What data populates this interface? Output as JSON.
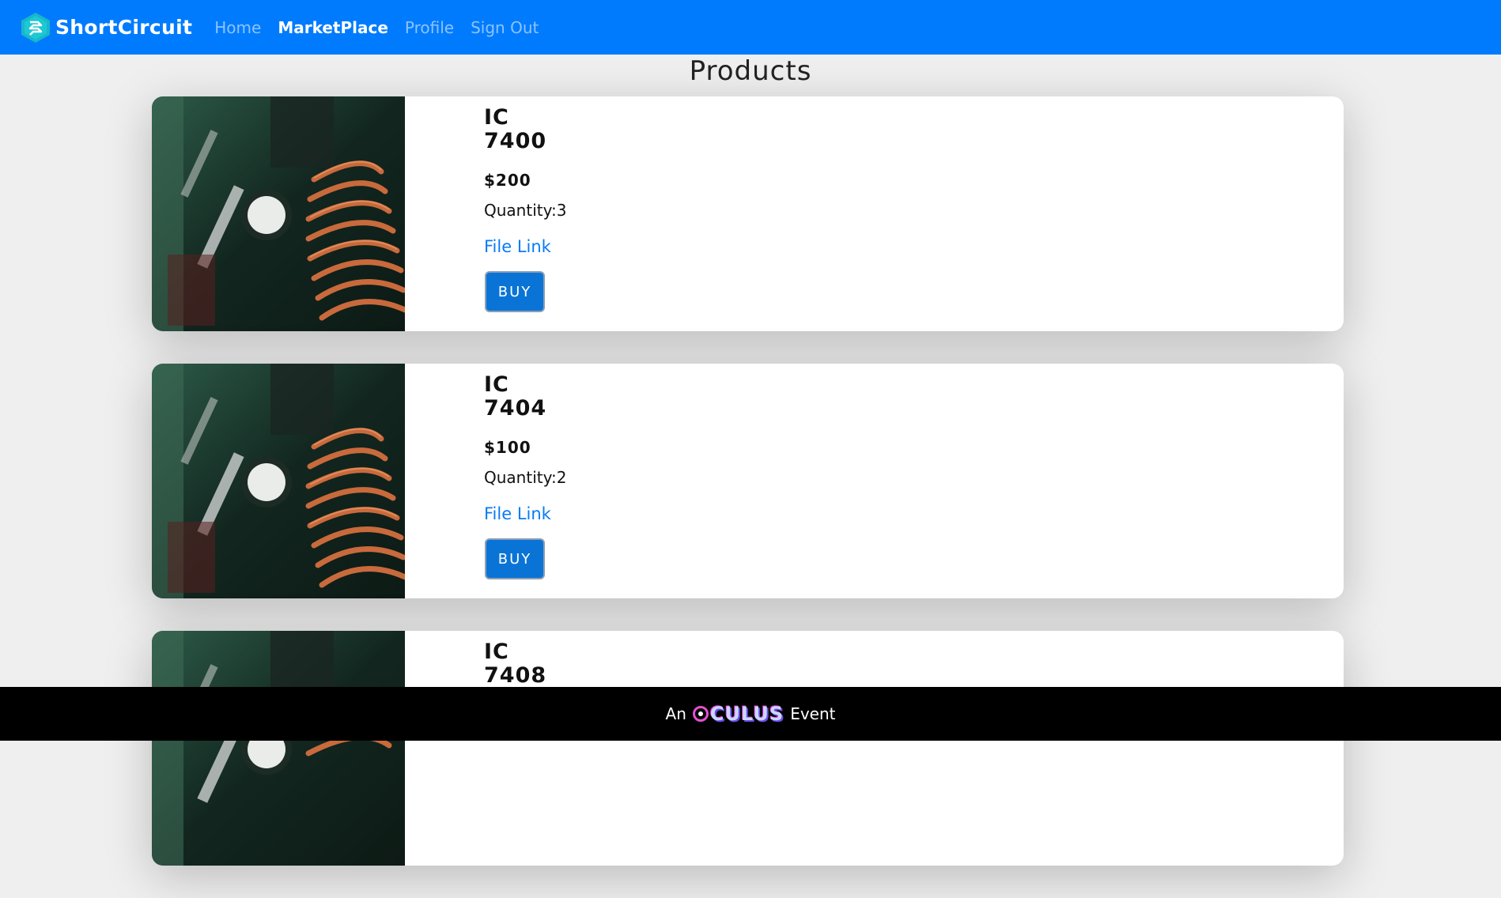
{
  "app": {
    "brand": "ShortCircuit"
  },
  "nav": [
    {
      "label": "Home",
      "active": false
    },
    {
      "label": "MarketPlace",
      "active": true
    },
    {
      "label": "Profile",
      "active": false
    },
    {
      "label": "Sign Out",
      "active": false
    }
  ],
  "page": {
    "title": "Products"
  },
  "products": [
    {
      "title_line1": "IC",
      "title_line2": "7400",
      "price": "$200",
      "quantity": "Quantity:3",
      "file_link": "File Link",
      "buy": "BUY"
    },
    {
      "title_line1": "IC",
      "title_line2": "7404",
      "price": "$100",
      "quantity": "Quantity:2",
      "file_link": "File Link",
      "buy": "BUY"
    },
    {
      "title_line1": "IC",
      "title_line2": "7408",
      "price": "",
      "quantity": "",
      "file_link": "",
      "buy": ""
    }
  ],
  "footer": {
    "prefix": "An",
    "brand": "CULUS",
    "suffix": "Event"
  },
  "colors": {
    "navbar": "#017bfe",
    "link": "#0a7bf4",
    "button": "#0a74d6",
    "footer": "#000000"
  }
}
